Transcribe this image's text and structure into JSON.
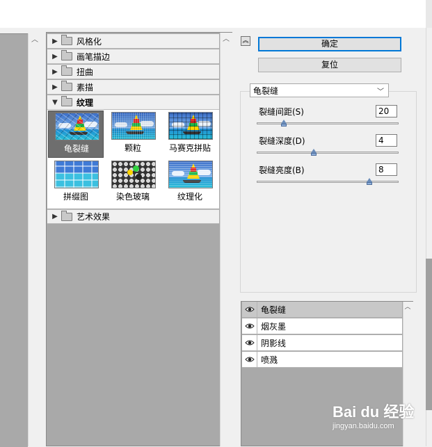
{
  "filter_categories_top": [
    {
      "label": "风格化",
      "expanded": false
    },
    {
      "label": "画笔描边",
      "expanded": false
    },
    {
      "label": "扭曲",
      "expanded": false
    },
    {
      "label": "素描",
      "expanded": false
    },
    {
      "label": "纹理",
      "expanded": true
    }
  ],
  "filter_categories_bottom": [
    {
      "label": "艺术效果",
      "expanded": false
    }
  ],
  "texture_filters": [
    {
      "label": "龟裂缝",
      "selected": true
    },
    {
      "label": "颗粒",
      "selected": false
    },
    {
      "label": "马赛克拼贴",
      "selected": false
    },
    {
      "label": "拼缀图",
      "selected": false
    },
    {
      "label": "染色玻璃",
      "selected": false
    },
    {
      "label": "纹理化",
      "selected": false
    }
  ],
  "buttons": {
    "ok_label": "确定",
    "reset_label": "复位"
  },
  "filter_select": {
    "value": "龟裂缝"
  },
  "params": [
    {
      "label": "裂缝间距(S)",
      "value": "20",
      "slider_fraction": 0.18
    },
    {
      "label": "裂缝深度(D)",
      "value": "4",
      "slider_fraction": 0.4
    },
    {
      "label": "裂缝亮度(B)",
      "value": "8",
      "slider_fraction": 0.8
    }
  ],
  "effect_layers": [
    {
      "label": "龟裂缝",
      "selected": true
    },
    {
      "label": "烟灰墨",
      "selected": false
    },
    {
      "label": "阴影线",
      "selected": false
    },
    {
      "label": "喷溅",
      "selected": false
    }
  ],
  "watermark": {
    "brand": "Bai du 经验",
    "url": "jingyan.baidu.com"
  }
}
